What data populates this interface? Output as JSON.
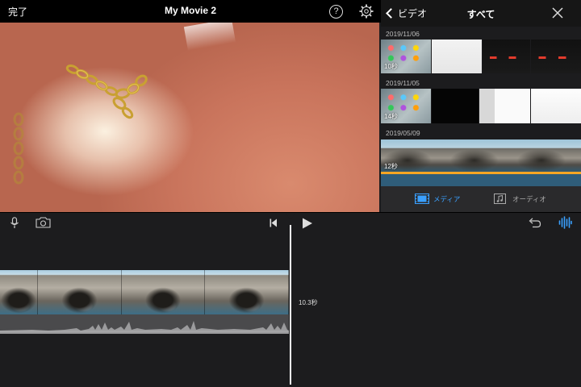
{
  "app": {
    "done_label": "完了",
    "project_title": "My Movie 2"
  },
  "topbar_icons": {
    "help_glyph": "?",
    "help_icon": "question-circle-icon",
    "settings_icon": "gear-icon"
  },
  "media_browser": {
    "back_label": "ビデオ",
    "title": "すべて",
    "close_icon": "close-icon",
    "groups": [
      {
        "date": "2019/11/06",
        "duration": "10秒",
        "thumbs": [
          "ipad-home",
          "white-screen",
          "dark-screen-red-accents"
        ]
      },
      {
        "date": "2019/11/05",
        "duration": "14秒",
        "thumbs": [
          "ipad-home",
          "black-screen",
          "settings-screen",
          "white-screen"
        ]
      },
      {
        "date": "2019/05/09",
        "duration": "12秒",
        "thumbs": [
          "coastal-rocks",
          "coastal-rocks",
          "coastal-rocks"
        ],
        "selected": true
      }
    ],
    "tabs": [
      {
        "label": "メディア",
        "icon": "filmstrip-icon",
        "active": true
      },
      {
        "label": "オーディオ",
        "icon": "music-note-icon",
        "active": false
      }
    ]
  },
  "timeline": {
    "clip_duration": "10.3秒",
    "icons": [
      "microphone-icon",
      "camera-icon",
      "skip-to-start-icon",
      "play-icon",
      "undo-icon",
      "waveform-icon"
    ]
  },
  "colors": {
    "accent": "#3aa0ff",
    "selection": "#f5a623",
    "background": "#1c1c1e"
  }
}
